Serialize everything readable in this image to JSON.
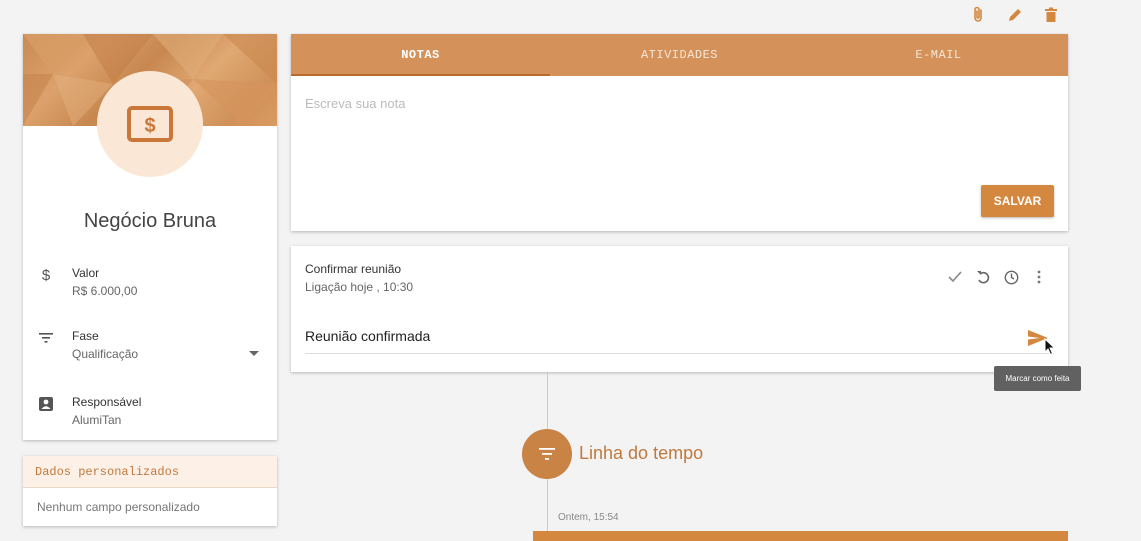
{
  "top_actions": [
    {
      "icon": "paperclip-icon"
    },
    {
      "icon": "pencil-icon"
    },
    {
      "icon": "trash-icon"
    }
  ],
  "deal": {
    "avatar_icon": "money-icon",
    "name": "Negócio Bruna",
    "fields": [
      {
        "icon": "dollar-icon",
        "label": "Valor",
        "value": "R$ 6.000,00"
      },
      {
        "icon": "filter-icon",
        "label": "Fase",
        "value": "Qualificação"
      },
      {
        "icon": "contact-card-icon",
        "label": "Responsável",
        "value": "AlumiTan"
      }
    ]
  },
  "custom_fields": {
    "title": "Dados personalizados",
    "empty_text": "Nenhum campo personalizado"
  },
  "notes": {
    "tabs": [
      {
        "label": "NOTAS",
        "active": true
      },
      {
        "label": "ATIVIDADES",
        "active": false
      },
      {
        "label": "E-MAIL",
        "active": false
      }
    ],
    "placeholder": "Escreva sua nota",
    "save_label": "SALVAR"
  },
  "activity": {
    "title": "Confirmar reunião",
    "subtitle": "Ligação hoje , 10:30",
    "tools": [
      "check-icon",
      "undo-icon",
      "clock-icon",
      "more-vert-icon"
    ],
    "reply_value": "Reunião confirmada",
    "send_icon": "send-icon"
  },
  "tooltip": "Marcar como feita",
  "timeline": {
    "title": "Linha do tempo",
    "entry_date": "Ontem, 15:54"
  },
  "colors": {
    "accent": "#d4925a",
    "accent_dark": "#c98344",
    "button": "#d4883f"
  }
}
